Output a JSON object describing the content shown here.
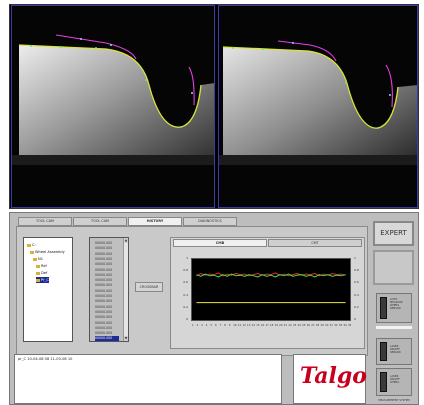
{
  "tabs": [
    "TOOL CAM",
    "TOOL CAM",
    "HISTORY",
    "DIAGNOSTICS"
  ],
  "tree": {
    "items": [
      "C:",
      "Wheel Assembly",
      "N1",
      "Ref",
      "Def",
      "Pr_C"
    ],
    "selected_index": 5
  },
  "values_list": {
    "items": [
      "00000.000",
      "00000.000",
      "00000.000",
      "00000.000",
      "00000.000",
      "00000.000",
      "00000.000",
      "00000.000",
      "00000.000",
      "00000.000",
      "00000.000",
      "00000.000",
      "00000.000",
      "00000.000",
      "00000.000",
      "00000.000",
      "00000.000",
      "00000.000",
      "00000.000"
    ],
    "selected_index": 18,
    "scroll_up": "▲",
    "scroll_down": "▼"
  },
  "cursor_button": "CROSSBAR",
  "graph": {
    "tabs": [
      "CMB",
      "CMT"
    ],
    "active_tab": 0,
    "y_left": [
      "1",
      "0.8",
      "0.6",
      "0.4",
      "0.2",
      "0"
    ],
    "y_right": [
      "1",
      "0.8",
      "0.6",
      "0.4",
      "0.2",
      "0"
    ],
    "x_labels": [
      "1",
      "2",
      "3",
      "4",
      "5",
      "6",
      "7",
      "8",
      "9",
      "10",
      "11",
      "12",
      "13",
      "14",
      "15",
      "16",
      "17",
      "18",
      "19",
      "20",
      "21",
      "22",
      "23",
      "24",
      "25",
      "26",
      "27",
      "28",
      "29",
      "30",
      "31",
      "32",
      "33",
      "34",
      "35"
    ],
    "colors": {
      "red": "#ff2a2a",
      "green": "#39e35a",
      "yellow": "#e7e83a"
    }
  },
  "chart_data": {
    "type": "line",
    "x": [
      1,
      2,
      3,
      4,
      5,
      6,
      7,
      8,
      9,
      10,
      11,
      12,
      13,
      14,
      15,
      16,
      17,
      18,
      19,
      20,
      21,
      22,
      23,
      24,
      25,
      26,
      27,
      28,
      29,
      30,
      31,
      32,
      33,
      34,
      35
    ],
    "series": [
      {
        "values": [
          0.74,
          0.78,
          0.75,
          0.77,
          0.76,
          0.79,
          0.74,
          0.77,
          0.75,
          0.78,
          0.76,
          0.77,
          0.74,
          0.76,
          0.78,
          0.75,
          0.77,
          0.76,
          0.79,
          0.75,
          0.77,
          0.74,
          0.76,
          0.78,
          0.75,
          0.77,
          0.76,
          0.78,
          0.74,
          0.77,
          0.75,
          0.78,
          0.76,
          0.77,
          0.75
        ]
      },
      {
        "values": [
          0.76,
          0.73,
          0.77,
          0.74,
          0.75,
          0.72,
          0.76,
          0.73,
          0.77,
          0.74,
          0.75,
          0.73,
          0.76,
          0.74,
          0.72,
          0.76,
          0.73,
          0.75,
          0.72,
          0.76,
          0.74,
          0.77,
          0.73,
          0.75,
          0.76,
          0.73,
          0.75,
          0.72,
          0.76,
          0.74,
          0.76,
          0.73,
          0.75,
          0.74,
          0.76
        ]
      },
      {
        "values": [
          0.27,
          0.27,
          0.27,
          0.27,
          0.27,
          0.27,
          0.27,
          0.27,
          0.27,
          0.27,
          0.27,
          0.27,
          0.27,
          0.27,
          0.27,
          0.27,
          0.27,
          0.27,
          0.27,
          0.27,
          0.27,
          0.27,
          0.27,
          0.27,
          0.27,
          0.27,
          0.27,
          0.27,
          0.27,
          0.27,
          0.27,
          0.27,
          0.27,
          0.27,
          0.27
        ]
      }
    ],
    "ylim": [
      0,
      1
    ]
  },
  "expert_button": "EXPERT",
  "side_boxes": [
    {
      "lines": [
        "AUTO",
        "MEASURE",
        "WHEEL",
        "SENSOR"
      ]
    },
    {
      "lines": [
        "LASER",
        "ON/OFF",
        "SENSOR"
      ]
    },
    {
      "lines": [
        "LASER",
        "ON/OFF",
        "WHEEL"
      ]
    }
  ],
  "status_text": "MEASUREMENT SYSTEM",
  "log_line": "pr_C   10-04-08 08   11-03-08 10",
  "logo_text": "Talgo",
  "cam_colors": {
    "profile": "#e53fe6",
    "wheel": "#d9e437",
    "marker": "#6fe07a"
  }
}
